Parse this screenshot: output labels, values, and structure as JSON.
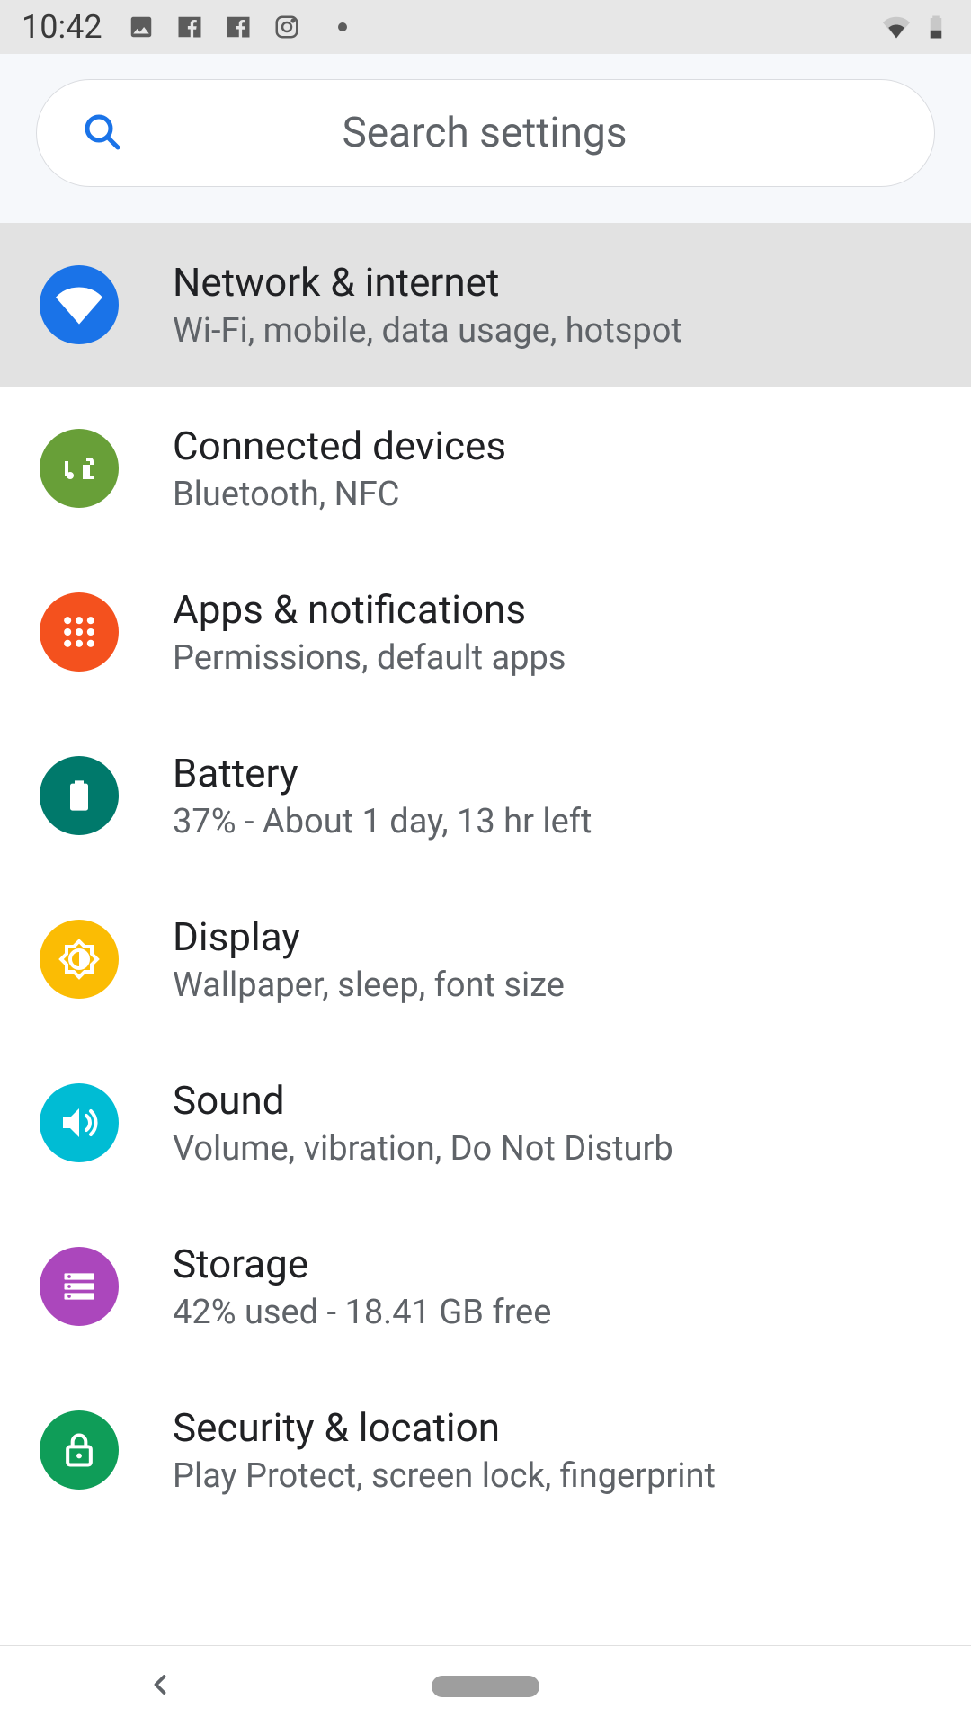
{
  "status": {
    "time": "10:42"
  },
  "search": {
    "placeholder": "Search settings"
  },
  "settings": [
    {
      "title": "Network & internet",
      "subtitle": "Wi-Fi, mobile, data usage, hotspot"
    },
    {
      "title": "Connected devices",
      "subtitle": "Bluetooth, NFC"
    },
    {
      "title": "Apps & notifications",
      "subtitle": "Permissions, default apps"
    },
    {
      "title": "Battery",
      "subtitle": "37% - About 1 day, 13 hr left"
    },
    {
      "title": "Display",
      "subtitle": "Wallpaper, sleep, font size"
    },
    {
      "title": "Sound",
      "subtitle": "Volume, vibration, Do Not Disturb"
    },
    {
      "title": "Storage",
      "subtitle": "42% used - 18.41 GB free"
    },
    {
      "title": "Security & location",
      "subtitle": "Play Protect, screen lock, fingerprint"
    }
  ]
}
